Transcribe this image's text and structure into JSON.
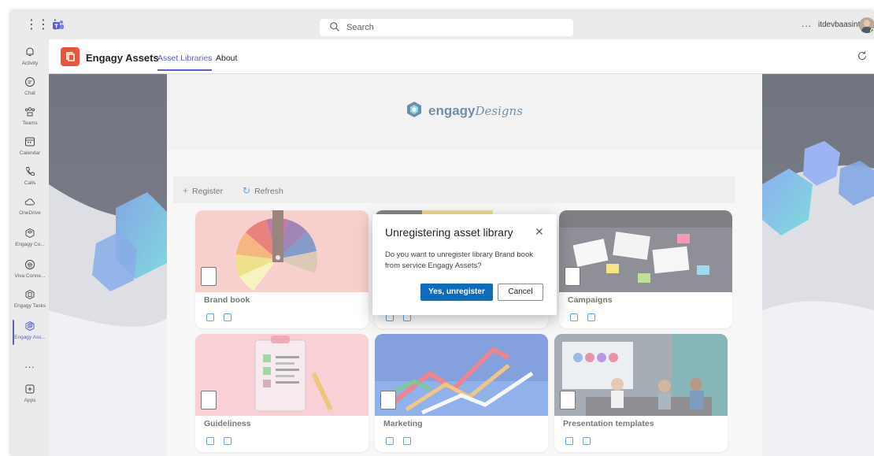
{
  "topbar": {
    "search_placeholder": "Search",
    "more_label": "...",
    "user_name": "itdevbaasint"
  },
  "rail": {
    "items": [
      {
        "label": "Activity",
        "icon": "bell-icon"
      },
      {
        "label": "Chat",
        "icon": "chat-icon"
      },
      {
        "label": "Teams",
        "icon": "teams-icon"
      },
      {
        "label": "Calendar",
        "icon": "calendar-icon"
      },
      {
        "label": "Calls",
        "icon": "phone-icon"
      },
      {
        "label": "OneDrive",
        "icon": "cloud-icon"
      },
      {
        "label": "Engagy Co...",
        "icon": "engagy-connect-icon"
      },
      {
        "label": "Viva Conne...",
        "icon": "viva-icon"
      },
      {
        "label": "Engagy Tasks",
        "icon": "tasks-icon"
      },
      {
        "label": "Engagy Ass...",
        "icon": "engagy-assets-icon"
      },
      {
        "label": "Apps",
        "icon": "apps-icon"
      }
    ],
    "more_label": "..."
  },
  "app_header": {
    "app_name": "Engagy Assets",
    "tabs": [
      {
        "label": "Asset Libraries",
        "active": true
      },
      {
        "label": "About",
        "active": false
      }
    ]
  },
  "brand": {
    "name_bold": "engagy",
    "name_light": "Designs"
  },
  "commands": {
    "register": "Register",
    "refresh": "Refresh"
  },
  "libraries": [
    {
      "title": "Brand book"
    },
    {
      "title": ""
    },
    {
      "title": "Campaigns"
    },
    {
      "title": "Guideliness"
    },
    {
      "title": "Marketing"
    },
    {
      "title": "Presentation templates"
    }
  ],
  "dialog": {
    "title": "Unregistering asset library",
    "message": "Do you want to unregister library Brand book from service Engagy Assets?",
    "confirm_label": "Yes, unregister",
    "cancel_label": "Cancel"
  },
  "colors": {
    "accent": "#5b5fc7",
    "primary_button": "#0f6cbd",
    "app_icon": "#e8553c",
    "brand_text": "#1a4a73"
  }
}
